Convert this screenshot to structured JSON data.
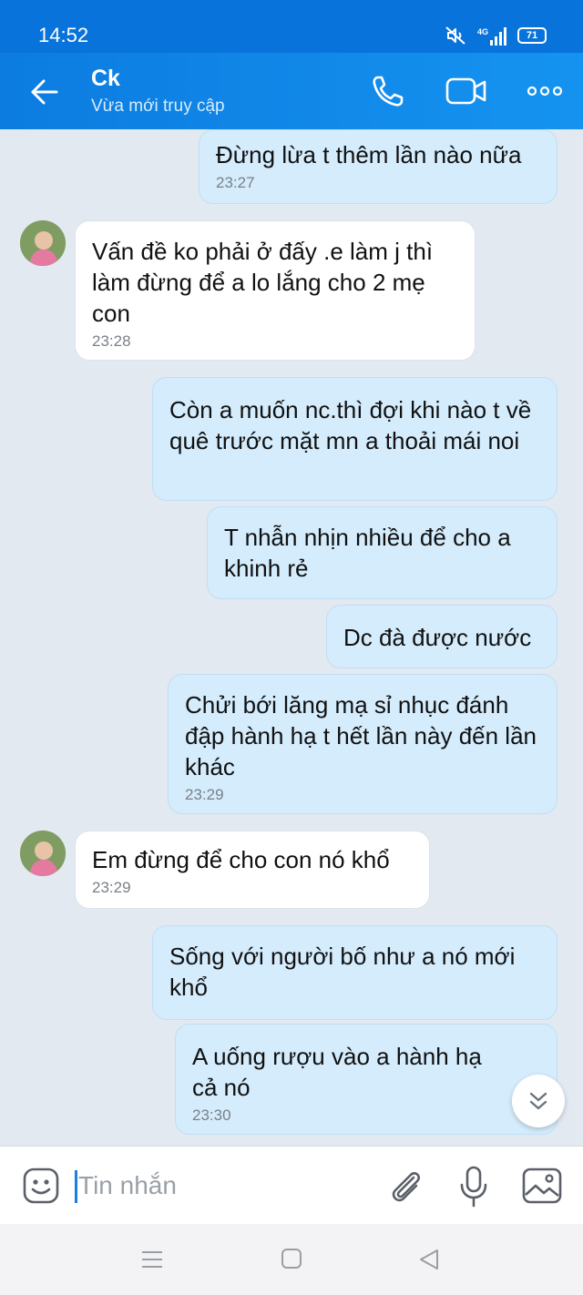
{
  "status_bar": {
    "time": "14:52",
    "network": "4G",
    "battery": "71"
  },
  "header": {
    "contact_name": "Ck",
    "contact_status": "Vừa mới truy cập"
  },
  "messages": [
    {
      "direction": "sent",
      "text": "Đừng lừa t thêm lần nào nữa",
      "time": "23:27"
    },
    {
      "direction": "received",
      "text": "Vấn đề ko phải ở đấy .e làm j thì làm đừng để a lo lắng cho 2 mẹ con",
      "time": "23:28"
    },
    {
      "direction": "sent",
      "text": "Còn a muốn nc.thì đợi khi nào t về quê trước mặt mn a thoải mái noi",
      "time": ""
    },
    {
      "direction": "sent",
      "text": "T nhẫn nhịn nhiều để cho a khinh rẻ",
      "time": ""
    },
    {
      "direction": "sent",
      "text": "Dc đà được nước",
      "time": ""
    },
    {
      "direction": "sent",
      "text": "Chửi bới lăng mạ sỉ nhục đánh đập hành hạ t hết lần này đến lần khác",
      "time": "23:29"
    },
    {
      "direction": "received",
      "text": "Em đừng để cho con nó khổ",
      "time": "23:29"
    },
    {
      "direction": "sent",
      "text": "Sống với người bố như a nó mới khổ",
      "time": ""
    },
    {
      "direction": "sent",
      "text": "A uống rượu vào a hành hạ cả nó",
      "time": "23:30"
    }
  ],
  "composer": {
    "placeholder": "Tin nhắn"
  },
  "colors": {
    "status_bar": "#0873da",
    "header": "#1593f0",
    "chat_background": "#e2e9f1",
    "sent_bubble": "#d4ecfc",
    "received_bubble": "#ffffff"
  },
  "icons": {
    "header": [
      "back-arrow-icon",
      "phone-icon",
      "video-camera-icon",
      "more-dots-icon"
    ],
    "composer": [
      "sticker-icon",
      "paperclip-icon",
      "microphone-icon",
      "image-gallery-icon"
    ],
    "navigation": [
      "menu-lines-icon",
      "home-square-icon",
      "back-triangle-icon"
    ],
    "chat": [
      "scroll-down-chevron-icon"
    ]
  }
}
